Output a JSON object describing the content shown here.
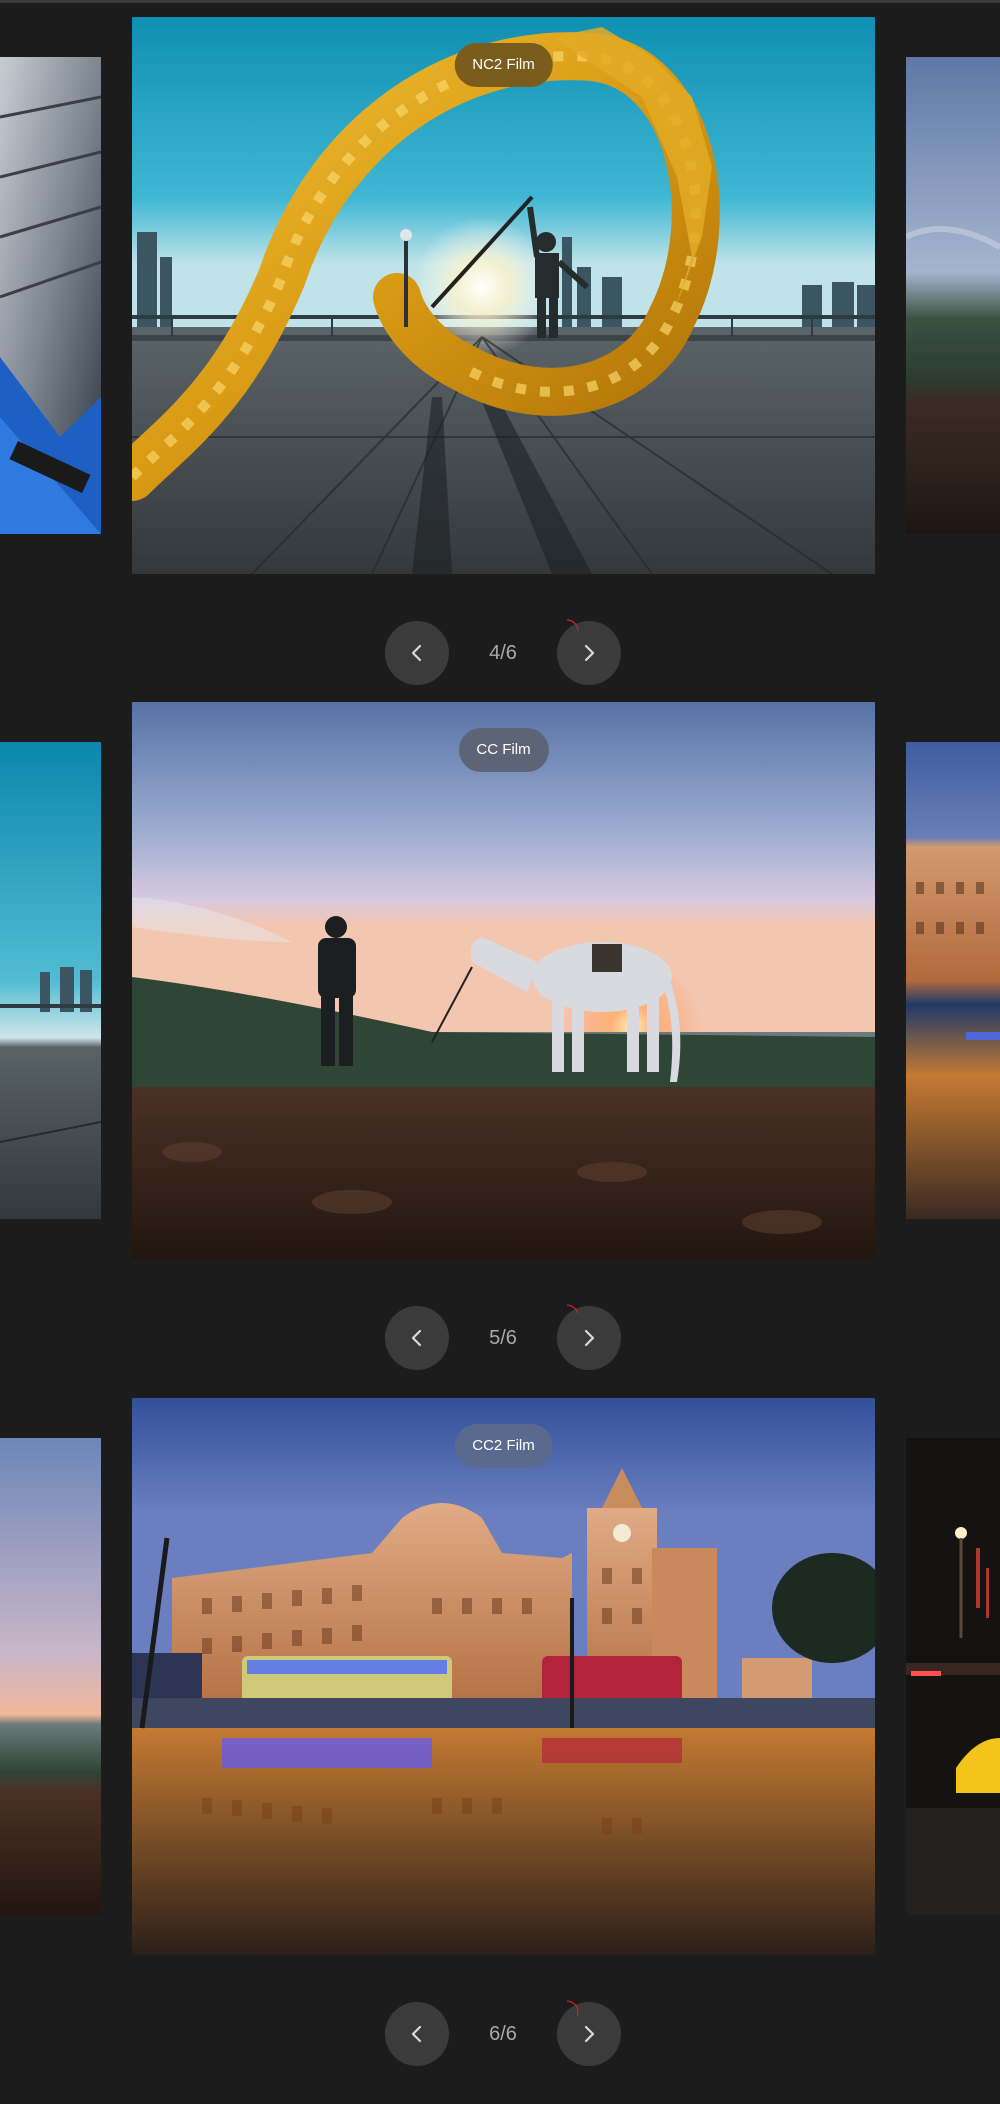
{
  "slides": [
    {
      "badge": "NC2 Film",
      "badge_color": "#7a5d1c",
      "counter": "4/6",
      "prev_icon": "chevron-left-icon",
      "next_icon": "chevron-right-icon",
      "progress_fraction": 0.25
    },
    {
      "badge": "CC Film",
      "badge_color": "#5d6478",
      "counter": "5/6",
      "prev_icon": "chevron-left-icon",
      "next_icon": "chevron-right-icon",
      "progress_fraction": 0.2
    },
    {
      "badge": "CC2 Film",
      "badge_color": "#5a6a8e",
      "counter": "6/6",
      "prev_icon": "chevron-left-icon",
      "next_icon": "chevron-right-icon",
      "progress_fraction": 0.3
    }
  ],
  "colors": {
    "background": "#1c1c1d",
    "button": "#3b3b3c",
    "progress_ring": "#e0252b",
    "counter_text": "#a9a9aa"
  }
}
